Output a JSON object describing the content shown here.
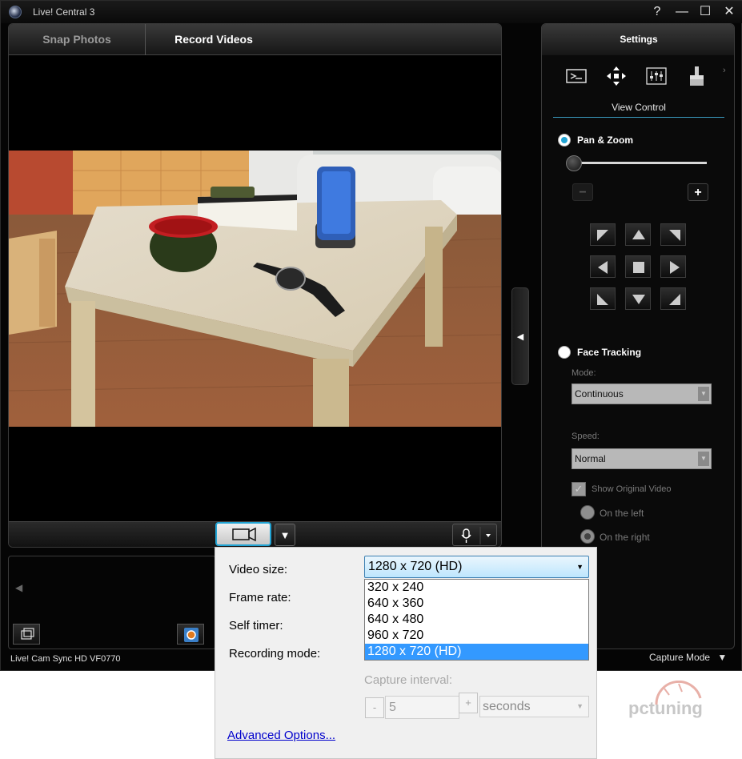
{
  "window": {
    "title": "Live! Central 3",
    "controls": {
      "help": "?",
      "minimize": "—",
      "maximize": "☐",
      "close": "✕"
    }
  },
  "tabs": {
    "snap": "Snap Photos",
    "record": "Record Videos",
    "active": "Record Videos"
  },
  "settings": {
    "title": "Settings",
    "section": "View Control",
    "icons": [
      "view-control-icon",
      "move-arrows-icon",
      "equalizer-icon",
      "brush-icon"
    ],
    "pan_zoom_label": "Pan & Zoom",
    "zoom_minus": "−",
    "zoom_plus": "+",
    "zoom_level": 0,
    "face_tracking_label": "Face Tracking",
    "mode_label": "Mode:",
    "mode_value": "Continuous",
    "speed_label": "Speed:",
    "speed_value": "Normal",
    "show_original_label": "Show Original Video",
    "on_left_label": "On the left",
    "on_right_label": "On the right",
    "pan_zoom_selected": true,
    "show_original_checked": true,
    "selected_position": "On the right"
  },
  "status": {
    "device": "Live! Cam Sync HD VF0770",
    "capture_mode": "Capture Mode"
  },
  "popup": {
    "video_size_label": "Video size:",
    "frame_rate_label": "Frame rate:",
    "self_timer_label": "Self timer:",
    "recording_mode_label": "Recording mode:",
    "video_size_value": "1280 x 720 (HD)",
    "video_size_options": [
      "320 x 240",
      "640 x 360",
      "640 x 480",
      "960 x 720",
      "1280 x 720 (HD)"
    ],
    "capture_interval_label": "Capture interval:",
    "interval_minus": "-",
    "interval_value": "5",
    "interval_plus": "+",
    "interval_unit": "seconds",
    "advanced_link": "Advanced Options..."
  },
  "watermark": {
    "text": "pctuning"
  },
  "colors": {
    "accent": "#22a4d4",
    "selection": "#3399ff",
    "link": "#0000cc"
  }
}
